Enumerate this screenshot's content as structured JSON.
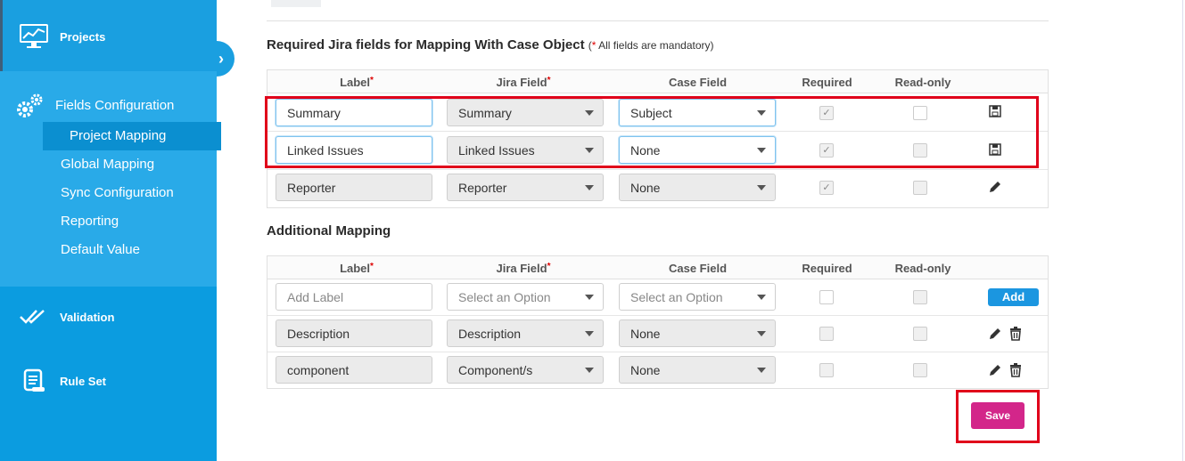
{
  "sidebar": {
    "projects_label": "Projects",
    "fields_config_label": "Fields Configuration",
    "sub_items": [
      "Project Mapping",
      "Global Mapping",
      "Sync Configuration",
      "Reporting",
      "Default Value"
    ],
    "validation_label": "Validation",
    "rule_set_label": "Rule Set",
    "collapse_glyph": "›"
  },
  "required_section": {
    "title": "Required Jira fields for Mapping With Case Object",
    "mandatory_star": "*",
    "mandatory_note": " All fields are mandatory)",
    "open_paren": "(",
    "headers": {
      "label": "Label",
      "jira_field": "Jira Field",
      "case_field": "Case Field",
      "required": "Required",
      "read_only": "Read-only"
    },
    "rows": [
      {
        "label": "Summary",
        "jira": "Summary",
        "case": "Subject",
        "required": "✓"
      },
      {
        "label": "Linked Issues",
        "jira": "Linked Issues",
        "case": "None",
        "required": "✓"
      },
      {
        "label": "Reporter",
        "jira": "Reporter",
        "case": "None",
        "required": "✓"
      }
    ]
  },
  "additional_section": {
    "title": "Additional Mapping",
    "headers": {
      "label": "Label",
      "jira_field": "Jira Field",
      "case_field": "Case Field",
      "required": "Required",
      "read_only": "Read-only"
    },
    "new_row": {
      "label_placeholder": "Add Label",
      "jira_placeholder": "Select an Option",
      "case_placeholder": "Select an Option",
      "add_label": "Add"
    },
    "rows": [
      {
        "label": "Description",
        "jira": "Description",
        "case": "None"
      },
      {
        "label": "component",
        "jira": "Component/s",
        "case": "None"
      }
    ]
  },
  "save_label": "Save",
  "colors": {
    "sidebar": "#0b9ce0",
    "accent": "#1b96e0",
    "save": "#d3268a",
    "highlight": "#e0001a"
  }
}
